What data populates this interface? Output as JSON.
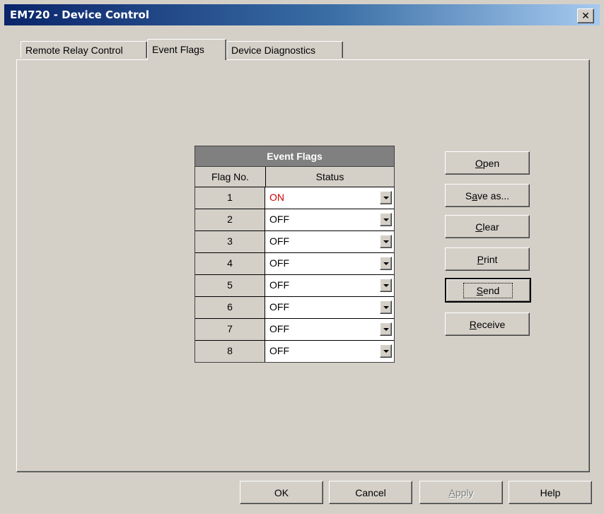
{
  "window": {
    "title": "EM720 - Device Control",
    "close_glyph": "✕"
  },
  "tabs": [
    {
      "label": "Remote Relay Control"
    },
    {
      "label": "Event Flags",
      "active": true
    },
    {
      "label": "Device Diagnostics"
    }
  ],
  "grid": {
    "title": "Event Flags",
    "columns": [
      "Flag No.",
      "Status"
    ],
    "rows": [
      {
        "flag": "1",
        "status": "ON"
      },
      {
        "flag": "2",
        "status": "OFF"
      },
      {
        "flag": "3",
        "status": "OFF"
      },
      {
        "flag": "4",
        "status": "OFF"
      },
      {
        "flag": "5",
        "status": "OFF"
      },
      {
        "flag": "6",
        "status": "OFF"
      },
      {
        "flag": "7",
        "status": "OFF"
      },
      {
        "flag": "8",
        "status": "OFF"
      }
    ],
    "on_color": "#cc0000"
  },
  "side_buttons": {
    "open": {
      "pre": "",
      "key": "O",
      "post": "pen"
    },
    "save_as": {
      "pre": "S",
      "key": "a",
      "post": "ve as..."
    },
    "clear": {
      "pre": "",
      "key": "C",
      "post": "lear"
    },
    "print": {
      "pre": "",
      "key": "P",
      "post": "rint"
    },
    "send": {
      "pre": "",
      "key": "S",
      "post": "end"
    },
    "receive": {
      "pre": "",
      "key": "R",
      "post": "eceive"
    }
  },
  "footer_buttons": {
    "ok": "OK",
    "cancel": "Cancel",
    "apply": {
      "pre": "",
      "key": "A",
      "post": "pply"
    },
    "help": "Help"
  }
}
